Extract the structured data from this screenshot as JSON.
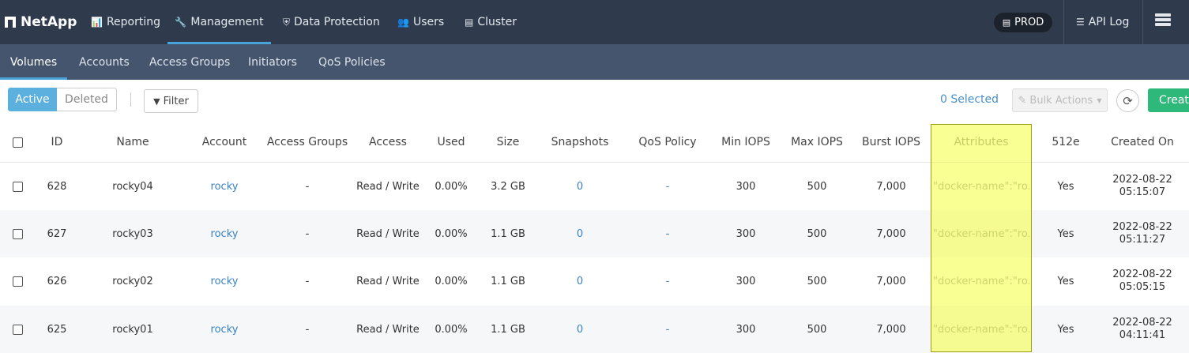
{
  "app": {
    "logo_text": "NetApp",
    "logo_icon": "netapp-logo-icon"
  },
  "top_nav": [
    {
      "label": "Reporting",
      "icon": "bar-chart-icon",
      "glyph": "📊"
    },
    {
      "label": "Management",
      "icon": "wrench-icon",
      "glyph": "🔧"
    },
    {
      "label": "Data Protection",
      "icon": "shield-icon",
      "glyph": "⛨"
    },
    {
      "label": "Users",
      "icon": "users-icon",
      "glyph": "👥"
    },
    {
      "label": "Cluster",
      "icon": "server-icon",
      "glyph": "▤"
    }
  ],
  "active_top_nav": "Management",
  "cluster_badge": {
    "label": "PROD",
    "icon": "server-icon",
    "glyph": "▤"
  },
  "api_log": {
    "label": "API Log",
    "icon": "list-icon",
    "glyph": "☰"
  },
  "sub_nav": [
    "Volumes",
    "Accounts",
    "Access Groups",
    "Initiators",
    "QoS Policies"
  ],
  "active_sub_nav": "Volumes",
  "toolbar": {
    "active_label": "Active",
    "deleted_label": "Deleted",
    "filter_label": "Filter",
    "filter_icon": "filter-icon",
    "filter_glyph": "▼",
    "selected_text": "0 Selected",
    "bulk_actions_label": "Bulk Actions",
    "bulk_icon": "pencil-icon",
    "bulk_glyph": "✎",
    "refresh_glyph": "⟳",
    "create_label": "Create"
  },
  "columns": [
    "ID",
    "Name",
    "Account",
    "Access Groups",
    "Access",
    "Used",
    "Size",
    "Snapshots",
    "QoS Policy",
    "Min IOPS",
    "Max IOPS",
    "Burst IOPS",
    "Attributes",
    "512e",
    "Created On"
  ],
  "rows": [
    {
      "id": "628",
      "name": "rocky04",
      "account": "rocky",
      "access_groups": "-",
      "access": "Read / Write",
      "used": "0.00%",
      "size": "3.2 GB",
      "snapshots": "0",
      "qos_policy": "-",
      "min_iops": "300",
      "max_iops": "500",
      "burst_iops": "7,000",
      "attributes": "\"docker-name\":\"ro...",
      "e512": "Yes",
      "created_date": "2022-08-22",
      "created_time": "05:15:07"
    },
    {
      "id": "627",
      "name": "rocky03",
      "account": "rocky",
      "access_groups": "-",
      "access": "Read / Write",
      "used": "0.00%",
      "size": "1.1 GB",
      "snapshots": "0",
      "qos_policy": "-",
      "min_iops": "300",
      "max_iops": "500",
      "burst_iops": "7,000",
      "attributes": "\"docker-name\":\"ro...",
      "e512": "Yes",
      "created_date": "2022-08-22",
      "created_time": "05:11:27"
    },
    {
      "id": "626",
      "name": "rocky02",
      "account": "rocky",
      "access_groups": "-",
      "access": "Read / Write",
      "used": "0.00%",
      "size": "1.1 GB",
      "snapshots": "0",
      "qos_policy": "-",
      "min_iops": "300",
      "max_iops": "500",
      "burst_iops": "7,000",
      "attributes": "\"docker-name\":\"ro...",
      "e512": "Yes",
      "created_date": "2022-08-22",
      "created_time": "05:05:15"
    },
    {
      "id": "625",
      "name": "rocky01",
      "account": "rocky",
      "access_groups": "-",
      "access": "Read / Write",
      "used": "0.00%",
      "size": "1.1 GB",
      "snapshots": "0",
      "qos_policy": "-",
      "min_iops": "300",
      "max_iops": "500",
      "burst_iops": "7,000",
      "attributes": "\"docker-name\":\"ro...",
      "e512": "Yes",
      "created_date": "2022-08-22",
      "created_time": "04:11:41"
    }
  ],
  "colors": {
    "top_bar": "#2f3b4c",
    "sub_bar": "#45556e",
    "accent": "#47a3d8",
    "create": "#2eb87a",
    "link": "#3a82c4",
    "highlight": "#f5ff3c"
  }
}
